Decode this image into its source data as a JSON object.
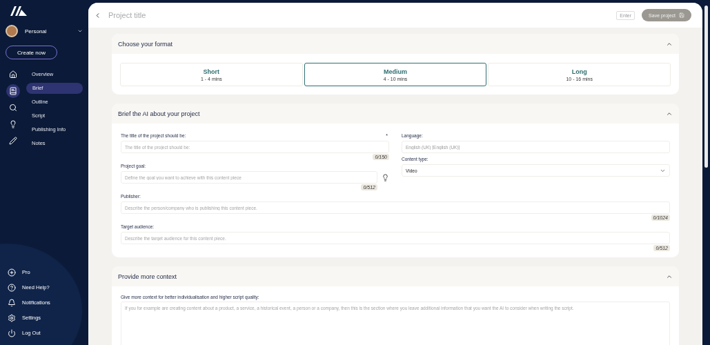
{
  "account": {
    "name": "Personal"
  },
  "create_button": "Create now",
  "rail": [
    {
      "kind": "home",
      "selected": false
    },
    {
      "kind": "book",
      "selected": true
    },
    {
      "kind": "search",
      "selected": false
    },
    {
      "kind": "bulb",
      "selected": false
    },
    {
      "kind": "pencil",
      "selected": false
    }
  ],
  "nav": [
    {
      "label": "Overview",
      "selected": false
    },
    {
      "label": "Brief",
      "selected": true
    },
    {
      "label": "Outline",
      "selected": false
    },
    {
      "label": "Script",
      "selected": false
    },
    {
      "label": "Publishing Info",
      "selected": false
    },
    {
      "label": "Notes",
      "selected": false
    }
  ],
  "footer_items": [
    {
      "kind": "plus",
      "label": "Pro"
    },
    {
      "kind": "help",
      "label": "Need Help?"
    },
    {
      "kind": "bell",
      "label": "Notifications"
    },
    {
      "kind": "gear",
      "label": "Settings"
    },
    {
      "kind": "power",
      "label": "Log Out"
    }
  ],
  "header": {
    "title_placeholder": "Project title",
    "enter_hint": "Enter",
    "save_button": "Save project",
    "save_disabled": true
  },
  "format": {
    "title": "Choose your format",
    "expanded": true,
    "options": [
      {
        "label": "Short",
        "duration": "1 - 4 mins",
        "selected": false
      },
      {
        "label": "Medium",
        "duration": "4 - 10 mins",
        "selected": true
      },
      {
        "label": "Long",
        "duration": "10 - 16 mins",
        "selected": false
      }
    ]
  },
  "brief": {
    "title": "Brief the AI about your project",
    "expanded": true,
    "left_fields": [
      {
        "kind": "text",
        "label": "The title of the project should be:",
        "required_mark": "*",
        "placeholder": "The title of the project should be:",
        "counter": "0/150",
        "suggest": false
      },
      {
        "kind": "text",
        "label": "Project goal:",
        "placeholder": "Define the goal you want to achieve with this content piece",
        "counter": "0/512",
        "suggest": true
      }
    ],
    "right_fields": [
      {
        "kind": "text",
        "label": "Language:",
        "value": "English (UK) [English (UK)]",
        "disabled": true
      },
      {
        "kind": "select",
        "label": "Content type:",
        "value": "Video"
      }
    ],
    "full_fields": [
      {
        "kind": "text",
        "label": "Publisher:",
        "placeholder": "Describe the person/company who is publishing this content piece.",
        "counter": "0/1024"
      },
      {
        "kind": "text",
        "label": "Target audience:",
        "placeholder": "Describe the target audience for this content piece.",
        "counter": "0/512"
      }
    ]
  },
  "context": {
    "title": "Provide more context",
    "expanded": true,
    "label": "Give more context for better individualisation and higher script quality:",
    "placeholder": "If you for example are creating content about a product, a service, a historical event, a person or a company, then this is the section where you leave additional information that you want the AI to consider when writing the script."
  }
}
